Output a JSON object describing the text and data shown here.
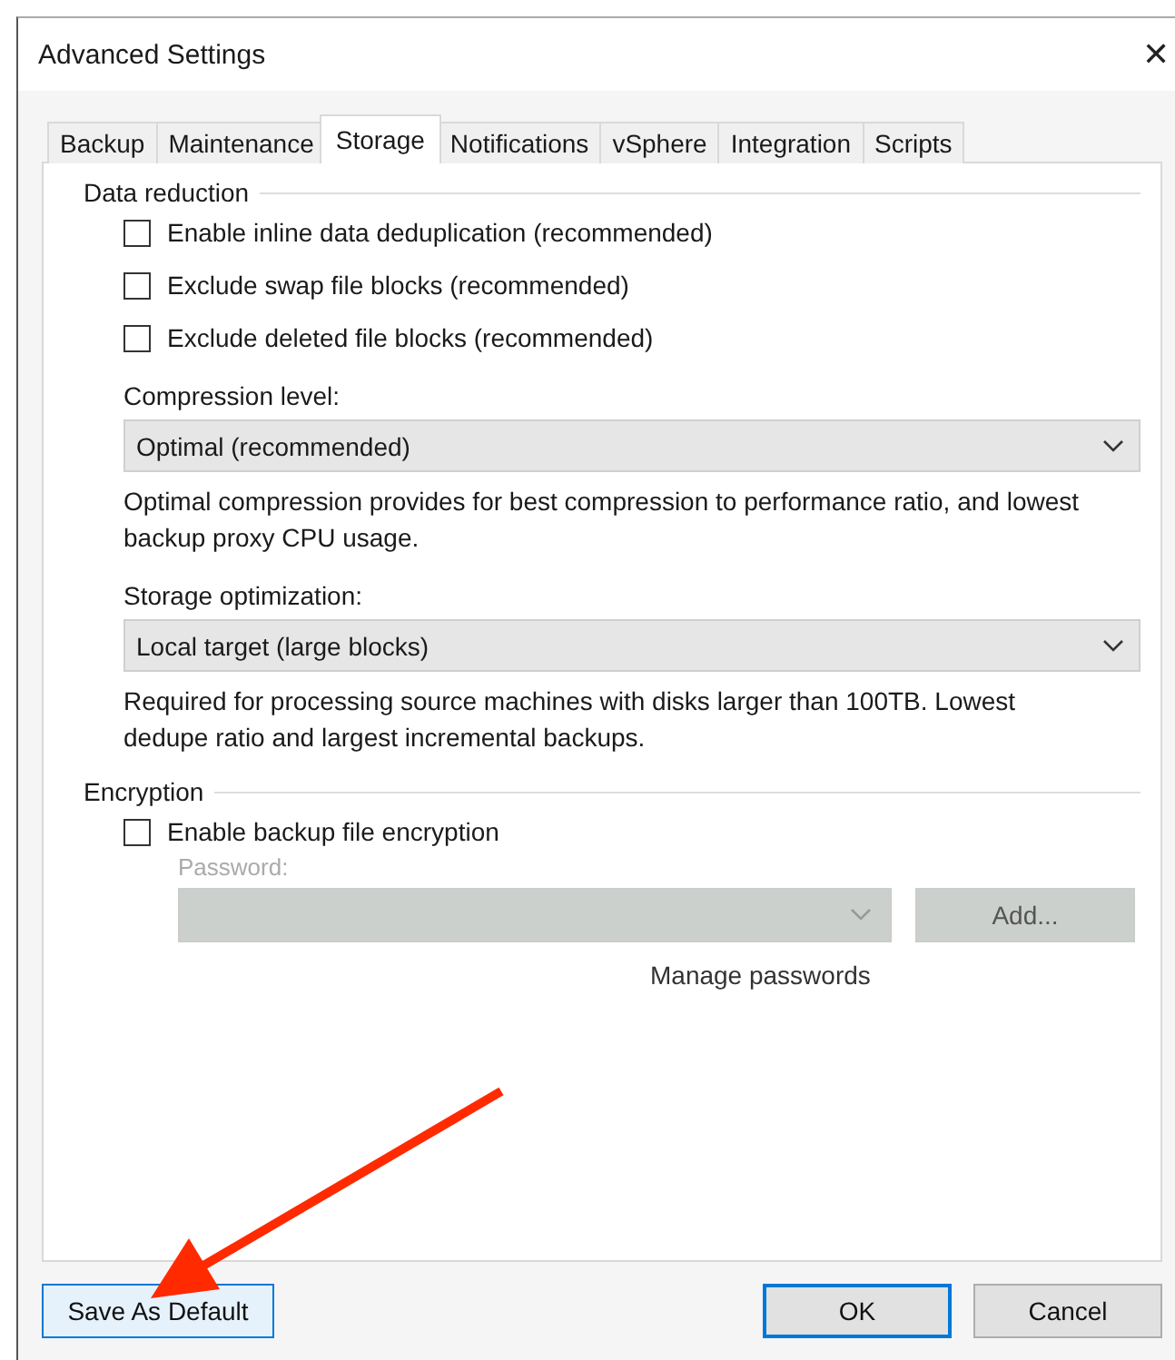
{
  "window": {
    "title": "Advanced Settings",
    "close": "✕"
  },
  "tabs": [
    {
      "label": "Backup",
      "selected": false
    },
    {
      "label": "Maintenance",
      "selected": false
    },
    {
      "label": "Storage",
      "selected": true
    },
    {
      "label": "Notifications",
      "selected": false
    },
    {
      "label": "vSphere",
      "selected": false
    },
    {
      "label": "Integration",
      "selected": false
    },
    {
      "label": "Scripts",
      "selected": false
    }
  ],
  "data_reduction": {
    "title": "Data reduction",
    "options": [
      {
        "label": "Enable inline data deduplication (recommended)",
        "checked": false
      },
      {
        "label": "Exclude swap file blocks (recommended)",
        "checked": false
      },
      {
        "label": "Exclude deleted file blocks (recommended)",
        "checked": false
      }
    ],
    "fields": [
      {
        "label": "Compression level:",
        "value": "Optimal (recommended)",
        "description": "Optimal compression provides for best compression to performance ratio, and lowest backup proxy CPU usage."
      },
      {
        "label": "Storage optimization:",
        "value": "Local target (large blocks)",
        "description": "Required for processing source machines with disks larger than 100TB. Lowest dedupe ratio and largest incremental backups."
      }
    ]
  },
  "encryption": {
    "title": "Encryption",
    "option": {
      "label": "Enable backup file encryption",
      "checked": false
    },
    "password": {
      "label": "Password:",
      "disabled": true
    },
    "add_button": {
      "label": "Add...",
      "disabled": true
    },
    "manage_link": "Manage passwords"
  },
  "buttons": {
    "save_default": "Save As Default",
    "ok": "OK",
    "cancel": "Cancel"
  }
}
